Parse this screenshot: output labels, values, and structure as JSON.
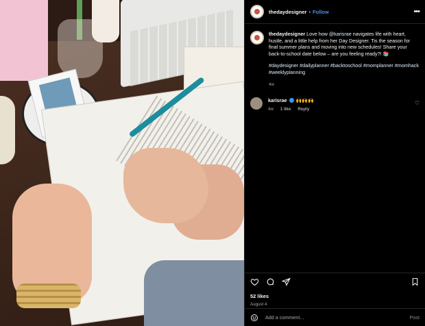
{
  "post": {
    "username": "thedaydesigner",
    "separator": "•",
    "follow_label": "Follow",
    "more_label": "•••"
  },
  "caption": {
    "username": "thedaydesigner",
    "text_1": " Love how ",
    "mention": "@karisrae",
    "text_2": " navigates life with heart, hustle, and a little help from her Day Designer. Tis the season for final summer plans and moving into new schedules! Share your back-to-school date below – are you feeling ready?! 📚",
    "hashtags": "#daydesigner #dailyplanner #backtoschool #momplanner #momhack #weeklyplanning",
    "age": "4w"
  },
  "comment": {
    "username": "karisrae",
    "emoji": "🙌🙌🙌",
    "age": "4w",
    "likes": "1 like",
    "reply": "Reply"
  },
  "engagement": {
    "likes": "52 likes",
    "date": "August 4"
  },
  "composer": {
    "placeholder": "Add a comment...",
    "post_label": "Post"
  },
  "colors": {
    "link_blue": "#4193ef",
    "panel_bg": "#000000",
    "muted": "#a8a8a8"
  }
}
